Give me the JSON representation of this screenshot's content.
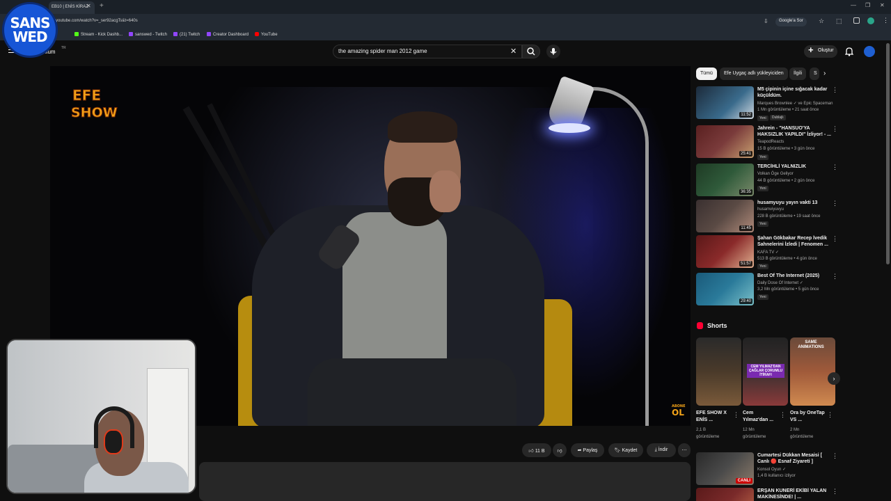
{
  "browser": {
    "tab_title": "EB10 | ENİS KİRAZ",
    "url": "youtube.com/watch?v=_ser92acgTs&t=640s",
    "google_ask": "Google'a Sor",
    "bookmarks": [
      {
        "label": "Stream - Kick Dashb...",
        "color": "#53fc18"
      },
      {
        "label": "sanswed - Twitch",
        "color": "#9146ff"
      },
      {
        "label": "(21) Twitch",
        "color": "#9146ff"
      },
      {
        "label": "Creator Dashboard",
        "color": "#9146ff"
      },
      {
        "label": "YouTube",
        "color": "#ff0000"
      }
    ]
  },
  "overlay": {
    "logo_line1": "SANS",
    "logo_line2": "WED"
  },
  "youtube": {
    "logo_text": "mium",
    "logo_tr": "TR",
    "search_value": "the amazing spider man 2012 game",
    "create_label": "Oluştur"
  },
  "video": {
    "channel_logo_line1": "EFE",
    "channel_logo_line2": "SHOW",
    "abone_line1": "ABONE",
    "abone_line2": "OL"
  },
  "actions": {
    "like_count": "11 B",
    "share": "Paylaş",
    "save": "Kaydet",
    "download": "İndir"
  },
  "sidebar": {
    "chips": [
      "Tümü",
      "Efe Uygaç adlı yükleyiciden",
      "İlgili",
      "S"
    ],
    "recommendations": [
      {
        "title": "M5 çipinin içine sığacak kadar küçüldüm.",
        "channel": "Marques Brownlee ✓ ve Epic Spaceman",
        "meta": "1 Mn görüntüleme • 21 saat önce",
        "badge": "Yeni",
        "badge2": "Dublajlı",
        "duration": "11:52",
        "thumb": "#3a6b8c"
      },
      {
        "title": "Jahrein - \"HANSUO'YA HAKSIZLIK YAPILDI\" İzliyor! - ...",
        "channel": "TeapodReacts",
        "meta": "15 B görüntüleme • 3 gün önce",
        "badge": "Yeni",
        "duration": "25:41",
        "thumb": "#7a3b3b"
      },
      {
        "title": "TERCİHLİ YALNIZLIK",
        "channel": "Volkan Öge Geliyor",
        "meta": "44 B görüntüleme • 2 gün önce",
        "badge": "Yeni",
        "duration": "36:35",
        "thumb": "#2f5a3a"
      },
      {
        "title": "husamyuyu yayın vakti 13",
        "channel": "husamviyuvyu",
        "meta": "228 B görüntüleme • 19 saat önce",
        "badge": "Yeni",
        "duration": "11:45",
        "thumb": "#5a4a44"
      },
      {
        "title": "Şahan Gökbakar Recep İvedik Sahnelerini İzledi | Fenomen ...",
        "channel": "KAFA TV ✓",
        "meta": "513 B görüntüleme • 4 gün önce",
        "badge": "Yeni",
        "duration": "51:57",
        "thumb": "#8a2a2a"
      },
      {
        "title": "Best Of The Internet (2025)",
        "channel": "Daily Dose Of Internet ✓",
        "meta": "3,2 Mn görüntüleme • 5 gün önce",
        "badge": "Yeni",
        "duration": "29:40",
        "thumb": "#2a7a9a"
      }
    ],
    "shorts_heading": "Shorts",
    "shorts": [
      {
        "title": "EFE SHOW X ENİS ...",
        "views_line1": "2,1 B",
        "views_line2": "görüntüleme",
        "thumb": "#4a3a2a",
        "overlay": ""
      },
      {
        "title": "Cem Yılmaz'dan ...",
        "views_line1": "12 Mn",
        "views_line2": "görüntüleme",
        "thumb": "#3a3030",
        "overlay": "CEM YILMAZ'DAN ÇAĞLAR ÇORUMLU İTİRAFI"
      },
      {
        "title": "Ora by OneTap VS ...",
        "views_line1": "2 Mn",
        "views_line2": "görüntüleme",
        "thumb": "#a05a3a",
        "overlay": "SAME ANIMATIONS"
      }
    ],
    "bottom_recs": [
      {
        "title": "Cumartesi Dükkan Mesaisi [ Canlı 🔴 Esnaf Ziyareti ]",
        "channel": "Konsol Oyun ✓",
        "meta": "1,4 B kullanıcı izliyor",
        "live": "CANLI",
        "thumb": "#3a3a3a"
      },
      {
        "title": "ERŞAN KUNERİ EKİBİ YALAN MAKİNESİNDE! | ...",
        "channel": "",
        "meta": "",
        "live": "",
        "thumb": "#7a2a2a"
      }
    ]
  }
}
